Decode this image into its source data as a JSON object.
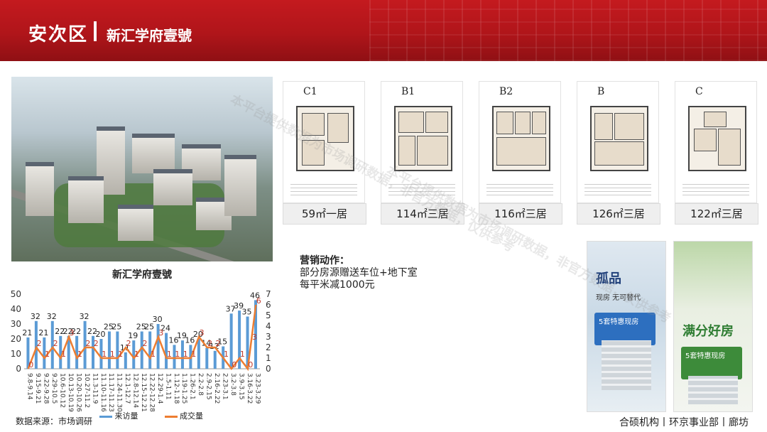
{
  "header": {
    "title": "安次区",
    "subtitle": "新汇学府壹號"
  },
  "project": {
    "label": "新汇学府壹號"
  },
  "floorplans": [
    {
      "code": "C1",
      "label": "59㎡一居"
    },
    {
      "code": "B1",
      "label": "114㎡三居"
    },
    {
      "code": "B2",
      "label": "116㎡三居"
    },
    {
      "code": "B",
      "label": "126㎡三居"
    },
    {
      "code": "C",
      "label": "122㎡三居"
    }
  ],
  "marketing": {
    "heading": "营销动作：",
    "line1": "部分房源赠送车位+地下室",
    "line2": "每平米减1000元"
  },
  "posters": [
    {
      "big": "孤品",
      "small": "现房 无可替代",
      "badge": "5套特惠现房"
    },
    {
      "big": "满分好房",
      "small": "",
      "badge": "5套特惠现房"
    }
  ],
  "watermark": "本平台提供数据为市场调研数据，非官方数据，仅供参考",
  "source": "数据来源：市场调研",
  "footer": "合硕机构丨环京事业部丨廊坊",
  "colors": {
    "header_red": "#c41a1f",
    "bar_blue": "#5b9bd5",
    "line_orange": "#ed7d31"
  },
  "chart_data": {
    "type": "bar",
    "categories": [
      "9.8-9.14",
      "9.15-9.21",
      "9.22-9.28",
      "9.29-10.5",
      "10.6-10.12",
      "10.13-10.19",
      "10.20-10.26",
      "10.27-11.2",
      "11.3-11.9",
      "11.10-11.16",
      "11.17-11.23",
      "11.24-11.30",
      "12.1-12.7",
      "12.8-12.14",
      "12.15-12.21",
      "12.22-12.28",
      "12.29-1.4",
      "1.5-1.11",
      "1.12-1.18",
      "1.19-1.25",
      "1.26-2.1",
      "2.2-2.8",
      "2.9-2.15",
      "2.16-2.22",
      "2.23-3.1",
      "3.2-3.8",
      "3.9-3.15",
      "3.16-3.22",
      "3.23-3.29"
    ],
    "series": [
      {
        "name": "来访量",
        "axis": "left",
        "values": [
          21,
          32,
          21,
          32,
          22,
          22,
          22,
          32,
          22,
          20,
          25,
          25,
          11,
          19,
          25,
          25,
          30,
          24,
          16,
          19,
          16,
          20,
          14,
          12,
          15,
          37,
          39,
          35,
          46
        ]
      },
      {
        "name": "成交量",
        "axis": "right",
        "values": [
          0,
          2,
          1,
          2,
          1,
          3,
          1,
          2,
          2,
          1,
          1,
          1,
          2,
          1,
          2,
          1,
          3,
          1,
          1,
          1,
          1,
          3,
          2,
          2,
          1,
          0,
          1,
          0,
          6
        ]
      }
    ],
    "extra_labels": [
      "3"
    ],
    "left_ticks": [
      "0",
      "10",
      "20",
      "30",
      "40",
      "50"
    ],
    "right_ticks": [
      "0",
      "1",
      "2",
      "3",
      "4",
      "5",
      "6",
      "7"
    ],
    "ylim_left": [
      0,
      50
    ],
    "ylim_right": [
      0,
      7
    ],
    "legend": "bottom"
  }
}
